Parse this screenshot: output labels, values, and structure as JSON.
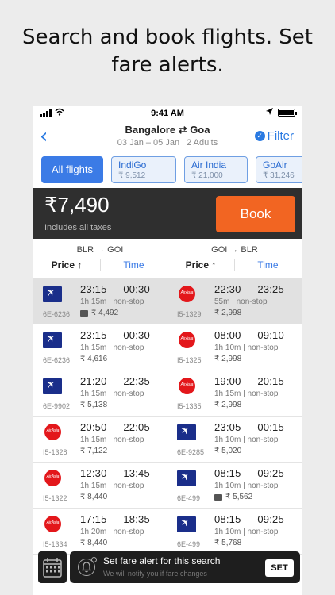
{
  "headline": {
    "line1": "Search and book flights. Set",
    "line2": "fare alerts."
  },
  "status_bar": {
    "time": "9:41 AM"
  },
  "nav": {
    "title": "Bangalore ⇄ Goa",
    "subtitle": "03 Jan – 05 Jan | 2 Adults",
    "filter_label": "Filter"
  },
  "chips": [
    {
      "label": "All flights"
    },
    {
      "name": "IndiGo",
      "price": "₹ 9,512"
    },
    {
      "name": "Air India",
      "price": "₹ 21,000"
    },
    {
      "name": "GoAir",
      "price": "₹ 31,246"
    }
  ],
  "booking": {
    "price": "₹7,490",
    "note": "Includes all taxes",
    "book_label": "Book"
  },
  "columns": {
    "onward": {
      "route": "BLR → GOI",
      "price_label": "Price ↑",
      "time_label": "Time"
    },
    "return": {
      "route": "GOI → BLR",
      "price_label": "Price ↑",
      "time_label": "Time"
    }
  },
  "rows": [
    {
      "onward": {
        "airline": "indigo",
        "code": "6E-6236",
        "times": "23:15  —  00:30",
        "duration": "1h 15m  | non-stop",
        "fare": "₹ 4,492",
        "wallet": true
      },
      "return": {
        "airline": "airasia",
        "code": "I5-1329",
        "times": "22:30  —  23:25",
        "duration": "55m  | non-stop",
        "fare": "₹ 2,998",
        "wallet": false
      }
    },
    {
      "onward": {
        "airline": "indigo",
        "code": "6E-6236",
        "times": "23:15  —  00:30",
        "duration": "1h 15m  | non-stop",
        "fare": "₹ 4,616",
        "wallet": false
      },
      "return": {
        "airline": "airasia",
        "code": "I5-1325",
        "times": "08:00  —  09:10",
        "duration": "1h 10m  | non-stop",
        "fare": "₹ 2,998",
        "wallet": false
      }
    },
    {
      "onward": {
        "airline": "indigo",
        "code": "6E-9902",
        "times": "21:20  —  22:35",
        "duration": "1h 15m  | non-stop",
        "fare": "₹ 5,138",
        "wallet": false
      },
      "return": {
        "airline": "airasia",
        "code": "I5-1335",
        "times": "19:00  —  20:15",
        "duration": "1h 15m  | non-stop",
        "fare": "₹ 2,998",
        "wallet": false
      }
    },
    {
      "onward": {
        "airline": "airasia",
        "code": "I5-1328",
        "times": "20:50  —  22:05",
        "duration": "1h 15m  | non-stop",
        "fare": "₹ 7,122",
        "wallet": false
      },
      "return": {
        "airline": "indigo",
        "code": "6E-9285",
        "times": "23:05  —  00:15",
        "duration": "1h 10m  | non-stop",
        "fare": "₹ 5,020",
        "wallet": false
      }
    },
    {
      "onward": {
        "airline": "airasia",
        "code": "I5-1322",
        "times": "12:30  —  13:45",
        "duration": "1h 15m  | non-stop",
        "fare": "₹ 8,440",
        "wallet": false
      },
      "return": {
        "airline": "indigo",
        "code": "6E-499",
        "times": "08:15  —  09:25",
        "duration": "1h 10m  | non-stop",
        "fare": "₹ 5,562",
        "wallet": true
      }
    },
    {
      "onward": {
        "airline": "airasia",
        "code": "I5-1334",
        "times": "17:15  —  18:35",
        "duration": "1h 20m  | non-stop",
        "fare": "₹ 8,440",
        "wallet": false
      },
      "return": {
        "airline": "indigo",
        "code": "6E-499",
        "times": "08:15  —  09:25",
        "duration": "1h 10m  | non-stop",
        "fare": "₹ 5,768",
        "wallet": false
      }
    }
  ],
  "fare_alert": {
    "title": "Set fare alert for this search",
    "subtitle": "We will notify you if fare changes",
    "set_label": "SET"
  },
  "colors": {
    "accent": "#3b7be6",
    "book": "#f26522",
    "dark_bar": "#2f2f2f"
  }
}
